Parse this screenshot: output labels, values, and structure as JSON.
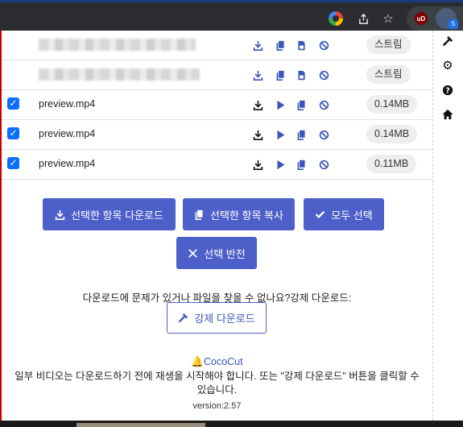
{
  "browser": {
    "ext_badge": "5",
    "ublock_label": "uD"
  },
  "rows": [
    {
      "name": "",
      "size": "스트림",
      "checked": false
    },
    {
      "name": "",
      "size": "스트림",
      "checked": false
    },
    {
      "name": "preview.mp4",
      "size": "0.14MB",
      "checked": true
    },
    {
      "name": "preview.mp4",
      "size": "0.14MB",
      "checked": true
    },
    {
      "name": "preview.mp4",
      "size": "0.11MB",
      "checked": true
    }
  ],
  "buttons": {
    "download_selected": "선택한 항목 다운로드",
    "copy_selected": "선택한 항목 복사",
    "select_all": "모두 선택",
    "invert_selection": "선택 반전",
    "force_download": "강제 다운로드"
  },
  "help_text": "다운로드에 문제가 있거나 파일을 찾을 수 없나요?강제 다운로드:",
  "footer": {
    "brand": "CocoCut",
    "note": "일부 비디오는 다운로드하기 전에 재생을 시작해야 합니다. 또는 \"강제 다운로드\" 버튼을 클릭할 수 있습니다.",
    "version": "version:2.57"
  },
  "colors": {
    "primary": "#4d5fc9",
    "checkbox": "#0d6efd",
    "badge_bg": "#eceef0"
  }
}
